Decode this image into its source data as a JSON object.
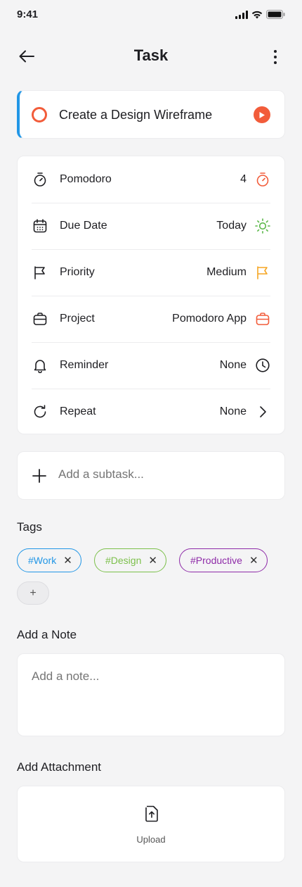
{
  "status_bar": {
    "time": "9:41"
  },
  "header": {
    "title": "Task"
  },
  "task": {
    "title": "Create a Design Wireframe",
    "accent_color": "#2196e6",
    "check_color": "#f25c3a"
  },
  "details": [
    {
      "label": "Pomodoro",
      "value": "4",
      "icon": "timer-icon",
      "right_icon": "timer-icon"
    },
    {
      "label": "Due Date",
      "value": "Today",
      "icon": "calendar-icon",
      "right_icon": "sun-icon"
    },
    {
      "label": "Priority",
      "value": "Medium",
      "icon": "flag-icon",
      "right_icon": "flag-icon"
    },
    {
      "label": "Project",
      "value": "Pomodoro App",
      "icon": "briefcase-icon",
      "right_icon": "briefcase-icon"
    },
    {
      "label": "Reminder",
      "value": "None",
      "icon": "bell-icon",
      "right_icon": "clock-icon"
    },
    {
      "label": "Repeat",
      "value": "None",
      "icon": "repeat-icon",
      "right_icon": "chevron-right-icon"
    }
  ],
  "subtask": {
    "placeholder": "Add a subtask..."
  },
  "tags": {
    "title": "Tags",
    "items": [
      {
        "label": "#Work",
        "color": "#2196e6"
      },
      {
        "label": "#Design",
        "color": "#7cc04b"
      },
      {
        "label": "#Productive",
        "color": "#8e2ba8"
      }
    ],
    "add_label": "+"
  },
  "note": {
    "title": "Add a Note",
    "placeholder": "Add a note..."
  },
  "attachment": {
    "title": "Add Attachment",
    "upload_label": "Upload"
  }
}
